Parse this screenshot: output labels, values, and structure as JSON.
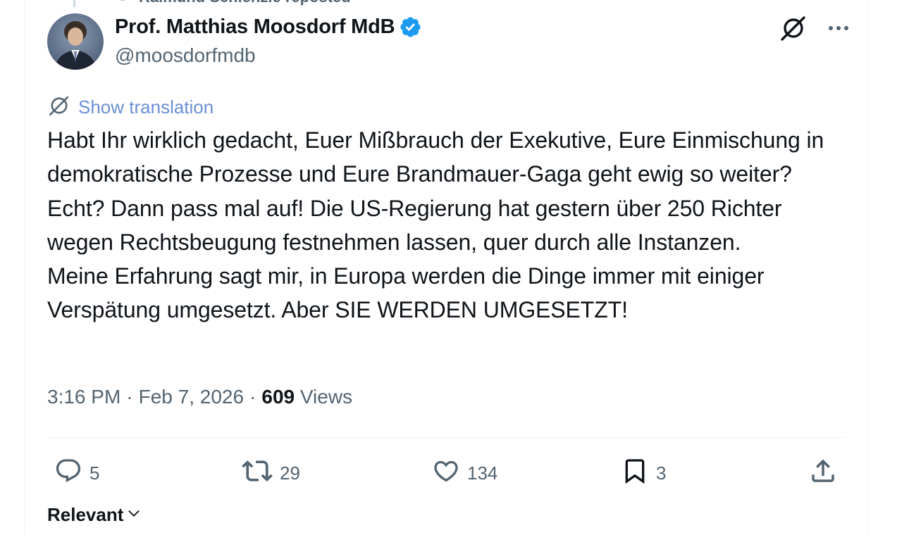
{
  "repost": {
    "label": "Raimund Schlenzle reposted",
    "icon": "repost-icon"
  },
  "author": {
    "display_name": "Prof. Matthias Moosdorf MdB",
    "handle": "@moosdorfmdb",
    "verified": true,
    "verified_color": "#1d9bf0",
    "avatar_icon": "avatar-photo"
  },
  "header_actions": {
    "grok_icon": "grok-icon",
    "more_icon": "more-icon"
  },
  "translation": {
    "label": "Show translation",
    "color": "#6b8fd6"
  },
  "tweet": {
    "paragraph1": "Habt Ihr wirklich gedacht, Euer Mißbrauch der Exekutive, Eure Einmischung in demokratische Prozesse und Eure Brandmauer-Gaga geht ewig so weiter? Echt? Dann pass mal auf! Die US-Regierung hat gestern über 250 Richter wegen Rechtsbeugung festnehmen lassen, quer durch alle Instanzen.",
    "paragraph2": "Meine Erfahrung sagt mir, in Europa werden die Dinge immer mit einiger Verspätung umgesetzt. Aber SIE WERDEN UMGESETZT!"
  },
  "meta": {
    "time": "3:16 PM",
    "separator": "·",
    "date": "Feb 7, 2026",
    "views_count": "609",
    "views_label": "Views"
  },
  "actions": {
    "replies": "5",
    "reposts": "29",
    "likes": "134",
    "bookmarks": "3"
  },
  "replies_sort": {
    "label": "Relevant"
  },
  "colors": {
    "text_primary": "#0f1419",
    "text_secondary": "#536471",
    "border": "#eff3f4"
  }
}
